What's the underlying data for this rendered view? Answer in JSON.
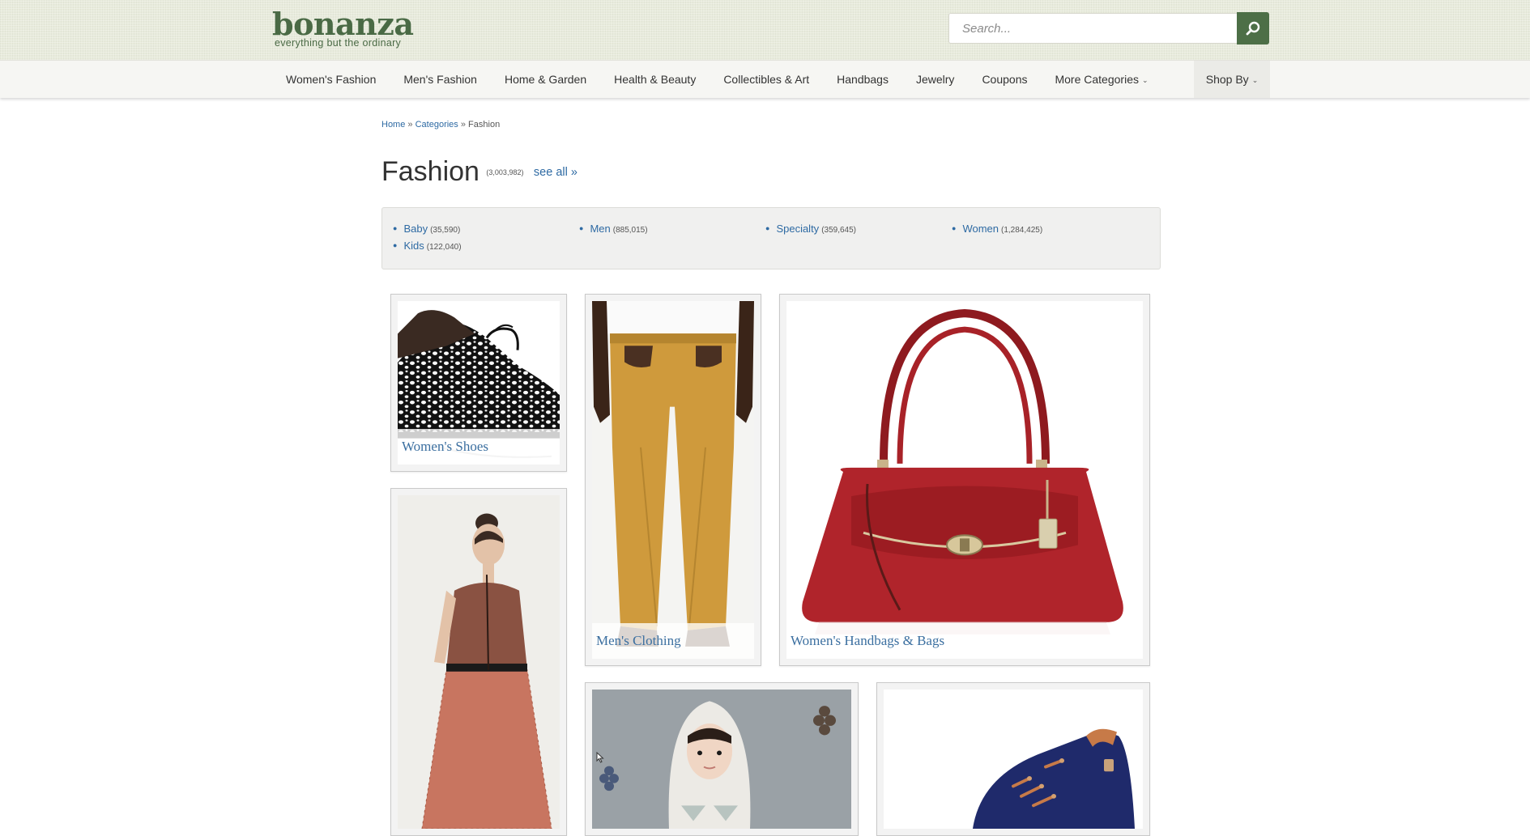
{
  "brand": {
    "name": "bonanza",
    "tagline": "everything but the ordinary",
    "color": "#4a6a45"
  },
  "search": {
    "placeholder": "Search...",
    "icon": "search-icon"
  },
  "nav": {
    "items": [
      {
        "label": "Women's Fashion"
      },
      {
        "label": "Men's Fashion"
      },
      {
        "label": "Home & Garden"
      },
      {
        "label": "Health & Beauty"
      },
      {
        "label": "Collectibles & Art"
      },
      {
        "label": "Handbags"
      },
      {
        "label": "Jewelry"
      },
      {
        "label": "Coupons"
      },
      {
        "label": "More Categories",
        "icon": "chevron-down-icon"
      }
    ],
    "shop_by": "Shop By"
  },
  "breadcrumb": {
    "home": "Home",
    "categories": "Categories",
    "separator": "»",
    "current": "Fashion"
  },
  "page": {
    "title": "Fashion",
    "count": "(3,003,982)",
    "see_all": "see all »"
  },
  "subcategories": [
    {
      "label": "Baby",
      "count": "(35,590)"
    },
    {
      "label": "Kids",
      "count": "(122,040)"
    },
    {
      "label": "Men",
      "count": "(885,015)"
    },
    {
      "label": "Specialty",
      "count": "(359,645)"
    },
    {
      "label": "Women",
      "count": "(1,284,425)"
    }
  ],
  "tiles": [
    {
      "label": "Women's Shoes",
      "image": "spotted-oxford-shoes"
    },
    {
      "label": "Men's Clothing",
      "image": "mustard-chino-pants"
    },
    {
      "label": "Women's Handbags & Bags",
      "image": "red-leather-handbag"
    },
    {
      "label": "",
      "image": "rust-lace-dress"
    },
    {
      "label": "",
      "image": "child-in-hoodie"
    },
    {
      "label": "",
      "image": "blue-suede-shoe"
    }
  ],
  "colors": {
    "link": "#2e6aa3",
    "search_button": "#4d6f47",
    "header_bg": "#e8ebdc",
    "nav_bg": "#f6f6f3"
  }
}
